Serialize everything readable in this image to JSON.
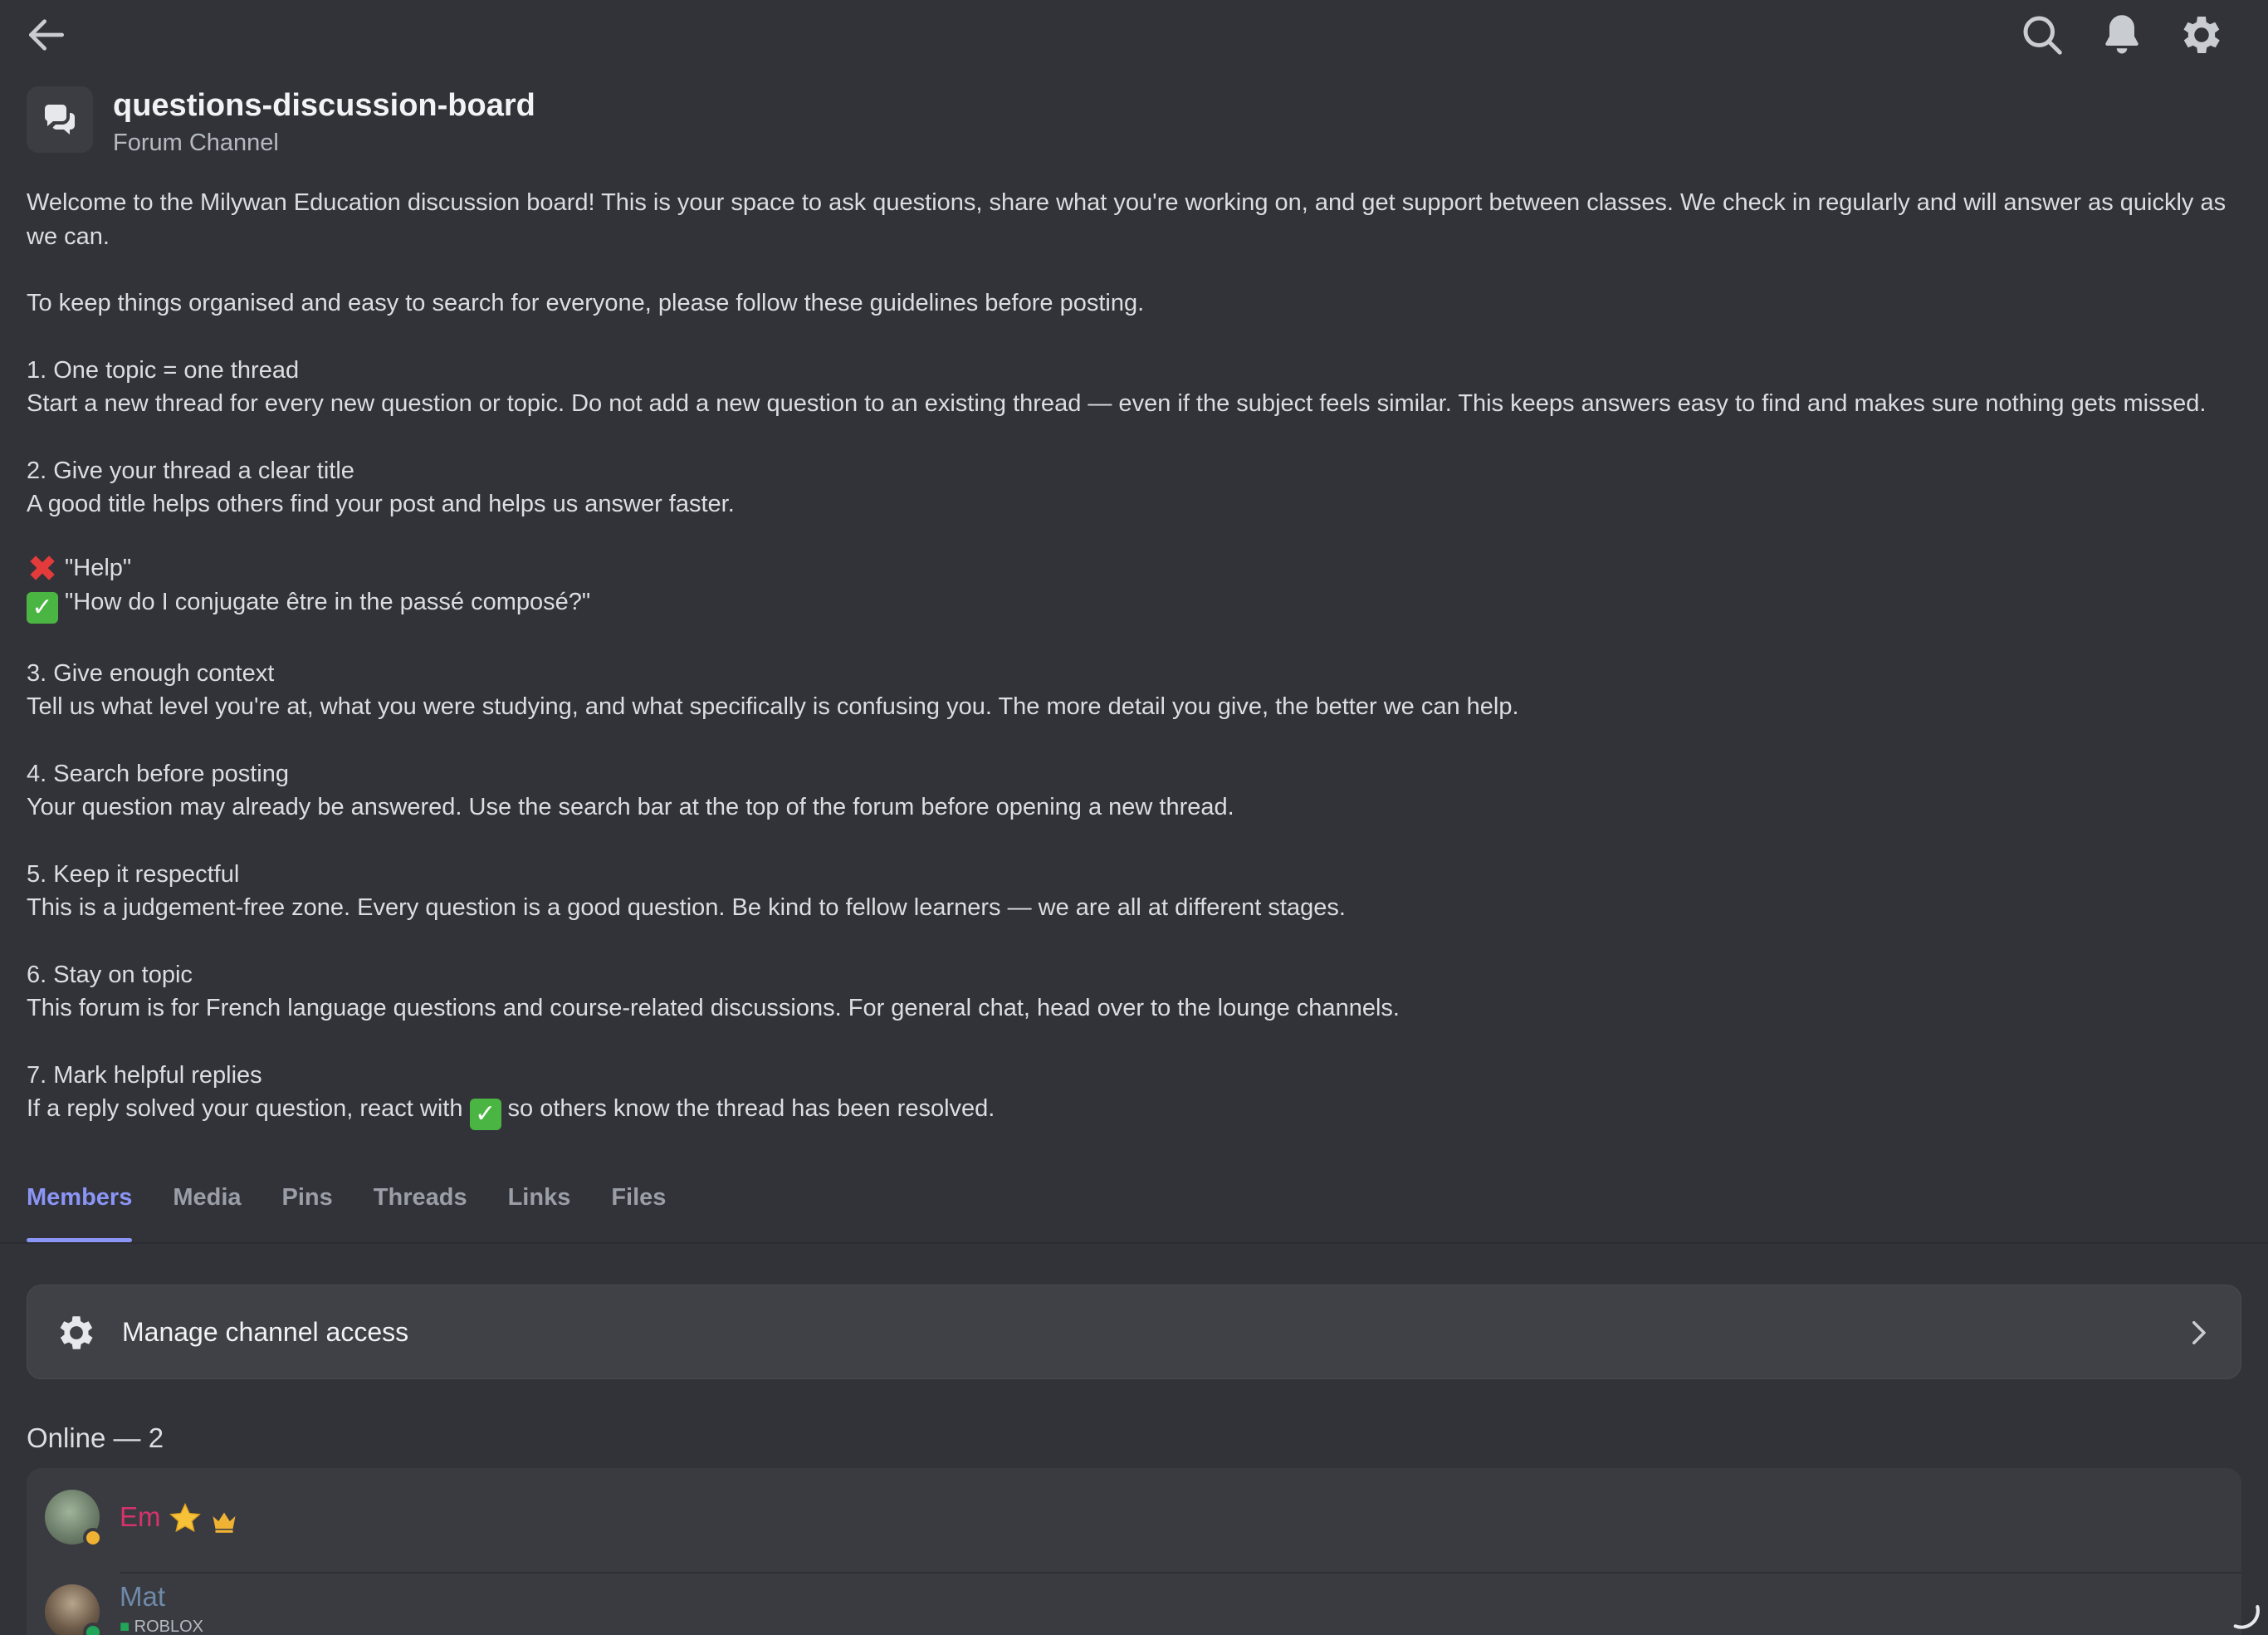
{
  "channel": {
    "name": "questions-discussion-board",
    "type": "Forum Channel"
  },
  "description": {
    "intro": "Welcome to the Milywan Education discussion board! This is your space to ask questions, share what you're working on, and get support between classes. We check in regularly and will answer as quickly as we can.",
    "guidelines_intro": "To keep things organised and easy to search for everyone, please follow these guidelines before posting.",
    "rules": [
      {
        "title": "1. One topic = one thread",
        "body": "Start a new thread for every new question or topic. Do not add a new question to an existing thread — even if the subject feels similar. This keeps answers easy to find and makes sure nothing gets missed."
      },
      {
        "title": "2. Give your thread a clear title",
        "body": "A good title helps others find your post and helps us answer faster."
      },
      {
        "title": "3. Give enough context",
        "body": "Tell us what level you're at, what you were studying, and what specifically is confusing you. The more detail you give, the better we can help."
      },
      {
        "title": "4. Search before posting",
        "body": "Your question may already be answered. Use the search bar at the top of the forum before opening a new thread."
      },
      {
        "title": "5. Keep it respectful",
        "body": "This is a judgement-free zone. Every question is a good question. Be kind to fellow learners — we are all at different stages."
      },
      {
        "title": "6. Stay on topic",
        "body": "This forum is for French language questions and course-related discussions. For general chat, head over to the lounge channels."
      },
      {
        "title": "7. Mark helpful replies",
        "body_before": "If a reply solved your question, react with",
        "body_after": "so others know the thread has been resolved."
      }
    ],
    "example_bad": "\"Help\"",
    "example_good": "\"How do I conjugate être in the passé composé?\""
  },
  "tabs": [
    "Members",
    "Media",
    "Pins",
    "Threads",
    "Links",
    "Files"
  ],
  "active_tab": "Members",
  "manage_access": {
    "label": "Manage channel access"
  },
  "online": {
    "header": "Online — 2",
    "members": [
      {
        "name": "Em",
        "color": "#d6336c",
        "badges": [
          "star-icon",
          "crown-icon"
        ]
      },
      {
        "name": "Mat",
        "color": "#6f8aa8",
        "status_text": "ROBLOX"
      }
    ]
  },
  "colors": {
    "background": "#323339",
    "accent": "#8b95f5",
    "text": "#dbdee1",
    "muted": "#b5bac1",
    "online": "#23a559",
    "idle": "#f0b232"
  },
  "icons": {
    "back": "arrow-left-icon",
    "search": "search-icon",
    "bell": "bell-icon",
    "settings": "gear-icon",
    "channel": "forum-icon",
    "chevron": "chevron-right-icon"
  }
}
